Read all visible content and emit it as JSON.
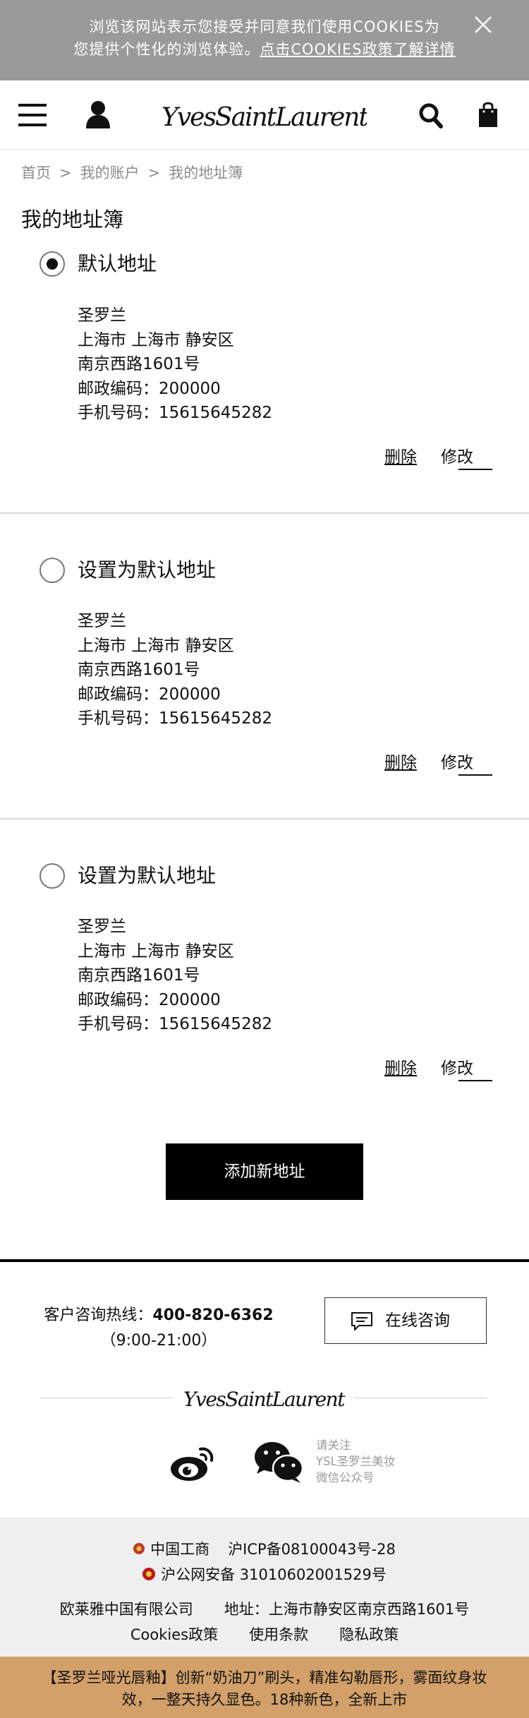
{
  "cookie_banner": {
    "line1": "浏览该网站表示您接受并同意我们使用COOKIES为",
    "line2_prefix": "您提供个性化的浏览体验。",
    "line2_link": "点击COOKIES政策了解详情",
    "close_icon": "close-icon"
  },
  "header": {
    "menu_icon": "hamburger-menu-icon",
    "account_icon": "user-icon",
    "logo_text": "YvesSaintLaurent",
    "search_icon": "search-icon",
    "bag_icon": "shopping-bag-icon"
  },
  "breadcrumb": {
    "items": [
      "首页",
      "我的账户",
      "我的地址簿"
    ],
    "separator": ">"
  },
  "page_title": "我的地址簿",
  "addresses": [
    {
      "selected": true,
      "radio_label": "默认地址",
      "name": "圣罗兰",
      "region": "上海市 上海市 静安区",
      "street": "南京西路1601号",
      "postcode": "邮政编码：200000",
      "phone": "手机号码：15615645282",
      "delete_label": "删除",
      "edit_label": "修改"
    },
    {
      "selected": false,
      "radio_label": "设置为默认地址",
      "name": "圣罗兰",
      "region": "上海市 上海市 静安区",
      "street": "南京西路1601号",
      "postcode": "邮政编码：200000",
      "phone": "手机号码：15615645282",
      "delete_label": "删除",
      "edit_label": "修改"
    },
    {
      "selected": false,
      "radio_label": "设置为默认地址",
      "name": "圣罗兰",
      "region": "上海市 上海市 静安区",
      "street": "南京西路1601号",
      "postcode": "邮政编码：200000",
      "phone": "手机号码：15615645282",
      "delete_label": "删除",
      "edit_label": "修改"
    }
  ],
  "add_address_label": "添加新地址",
  "footer": {
    "hotline_label": "客户咨询热线：",
    "hotline_number": "400-820-6362",
    "hotline_hours": "（9:00-21:00）",
    "chat_label": "在线咨询",
    "logo_text": "YvesSaintLaurent",
    "wechat_lines": [
      "请关注",
      "YSL圣罗兰美妆",
      "微信公众号"
    ],
    "icp_label": "中国工商",
    "icp_number": "沪ICP备08100043号-28",
    "police_label": "沪公网安备 31010602001529号",
    "company": "欧莱雅中国有限公司",
    "company_address": "地址：上海市静安区南京西路1601号",
    "links": [
      "Cookies政策",
      "使用条款",
      "隐私政策"
    ]
  },
  "promo": {
    "text": "【圣罗兰哑光唇釉】创新“奶油刀”刷头，精准勾勒唇形，雾面纹身妆效，一整天持久显色。18种新色，全新上市"
  },
  "colors": {
    "cookie_bg": "#9a9a9a",
    "promo_bg": "#d3a06a",
    "legal_bg": "#efefef",
    "button_bg": "#000000"
  }
}
